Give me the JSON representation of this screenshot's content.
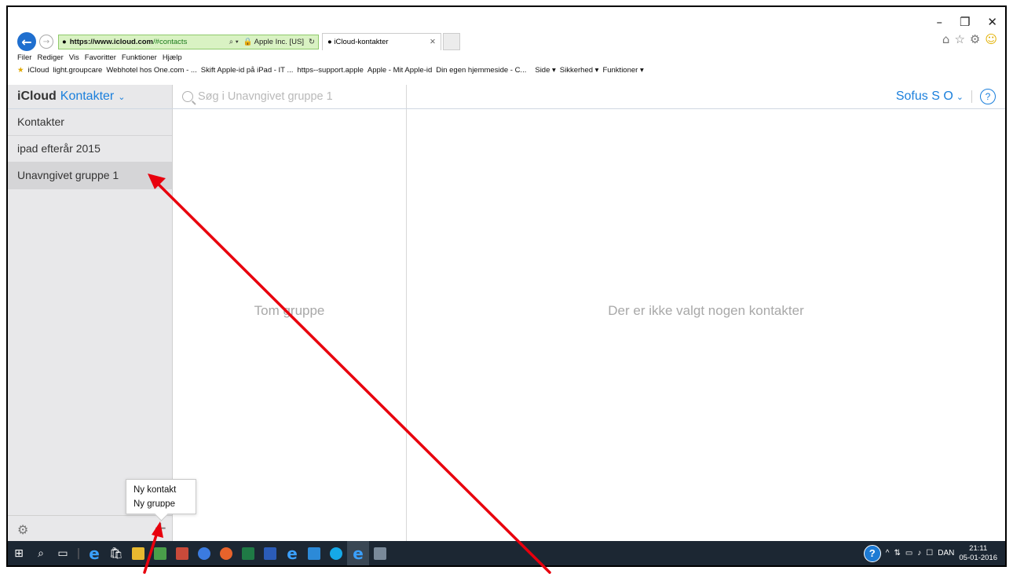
{
  "browser": {
    "window_controls": [
      "–",
      "❐",
      "✕"
    ],
    "url_host": "https://www.icloud.com",
    "url_path": "/#contacts",
    "ssl_identity": "Apple Inc. [US]",
    "tab_title": "iCloud-kontakter",
    "menu": [
      "Filer",
      "Rediger",
      "Vis",
      "Favoritter",
      "Funktioner",
      "Hjælp"
    ],
    "favorites": [
      "iCloud",
      "light.groupcare",
      "Webhotel hos One.com - ...",
      "Skift Apple-id på iPad - IT ...",
      "https--support.apple",
      "Apple - Mit Apple-id",
      "Din egen hjemmeside - C..."
    ],
    "command_bar": [
      "Side ▾",
      "Sikkerhed ▾",
      "Funktioner ▾"
    ]
  },
  "app": {
    "brand": "iCloud",
    "app_name": "Kontakter",
    "search_placeholder": "Søg i Unavngivet gruppe 1",
    "user": "Sofus S O",
    "help": "?"
  },
  "sidebar": {
    "items": [
      {
        "label": "Kontakter",
        "selected": false
      },
      {
        "label": "ipad efterår 2015",
        "selected": false
      },
      {
        "label": "Unavngivet gruppe 1",
        "selected": true
      }
    ]
  },
  "popup": {
    "items": [
      "Ny kontakt",
      "Ny gruppe"
    ]
  },
  "middle": {
    "empty_text": "Tom gruppe"
  },
  "detail": {
    "empty_text": "Der er ikke valgt nogen kontakter"
  },
  "taskbar": {
    "language": "DAN",
    "time": "21:11",
    "date": "05-01-2016"
  },
  "annotation_color": "#e8000d",
  "accent_color": "#1a7fdc"
}
